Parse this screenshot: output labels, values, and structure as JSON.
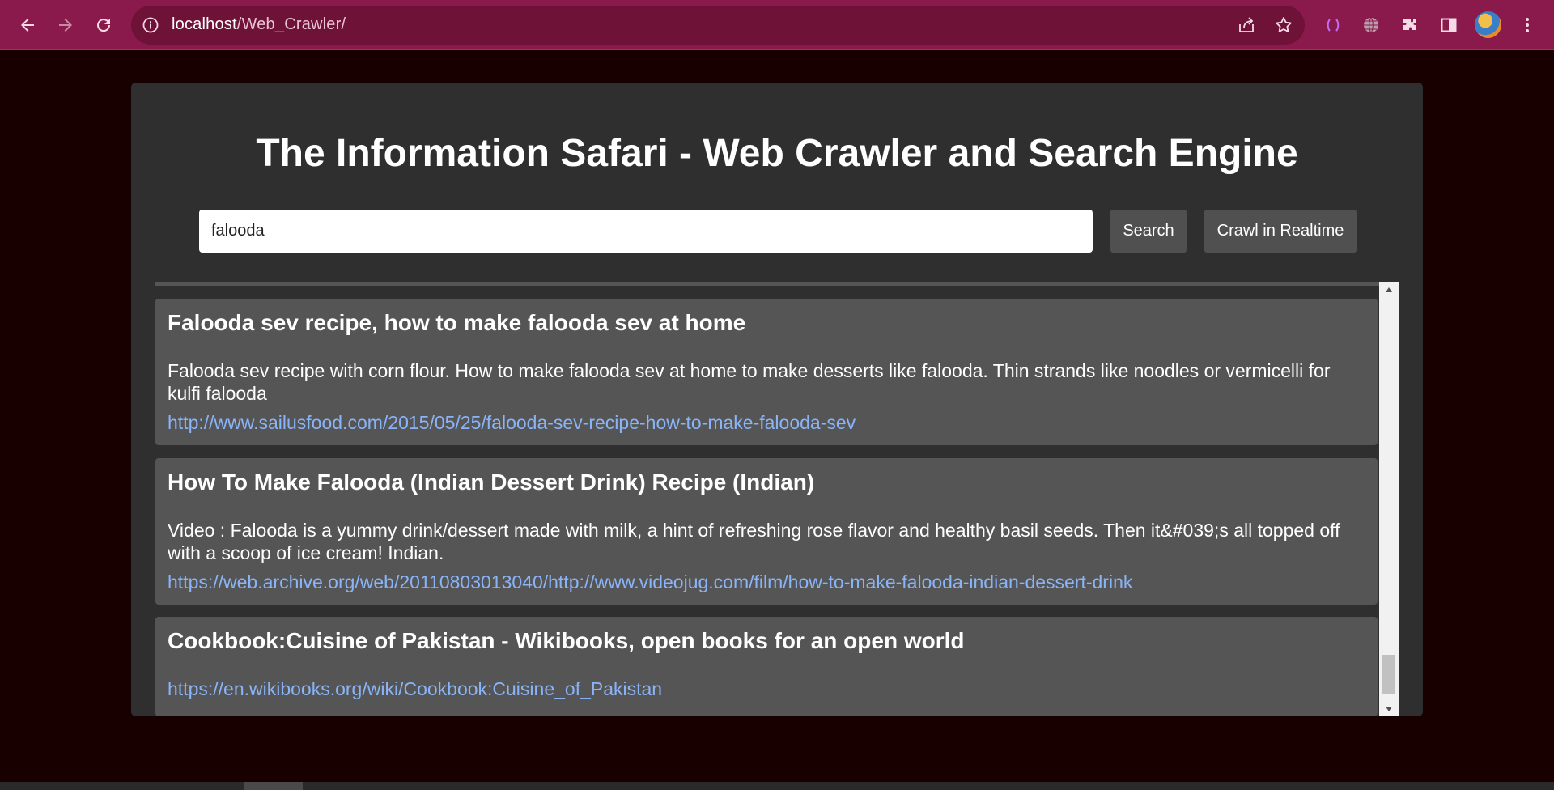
{
  "browser": {
    "url_host": "localhost",
    "url_path": "/Web_Crawler/",
    "icons": [
      "back-icon",
      "forward-icon",
      "reload-icon",
      "site-info-icon",
      "share-icon",
      "bookmark-star-icon",
      "extension-bracket-icon",
      "globe-icon",
      "puzzle-extensions-icon",
      "side-panel-icon",
      "profile-avatar",
      "more-menu-icon"
    ]
  },
  "page": {
    "title": "The Information Safari - Web Crawler and Search Engine",
    "search": {
      "value": "falooda",
      "search_label": "Search",
      "crawl_label": "Crawl in Realtime"
    },
    "results": [
      {
        "title": "Falooda sev recipe, how to make falooda sev at home",
        "description": "Falooda sev recipe with corn flour. How to make falooda sev at home to make desserts like falooda. Thin strands like noodles or vermicelli for kulfi falooda",
        "url": "http://www.sailusfood.com/2015/05/25/falooda-sev-recipe-how-to-make-falooda-sev"
      },
      {
        "title": "How To Make Falooda (Indian Dessert Drink) Recipe (Indian)",
        "description": "Video : Falooda is a yummy drink/dessert made with milk, a hint of refreshing rose flavor and healthy basil seeds. Then it&#039;s all topped off with a scoop of ice cream! Indian.",
        "url": "https://web.archive.org/web/20110803013040/http://www.videojug.com/film/how-to-make-falooda-indian-dessert-drink"
      },
      {
        "title": "Cookbook:Cuisine of Pakistan - Wikibooks, open books for an open world",
        "description": "",
        "url": "https://en.wikibooks.org/wiki/Cookbook:Cuisine_of_Pakistan"
      }
    ]
  },
  "colors": {
    "browser_toolbar": "#8a1a4b",
    "page_background": "#180000",
    "container": "#2f2f2f",
    "card": "#555555",
    "link": "#8ab4f8"
  }
}
